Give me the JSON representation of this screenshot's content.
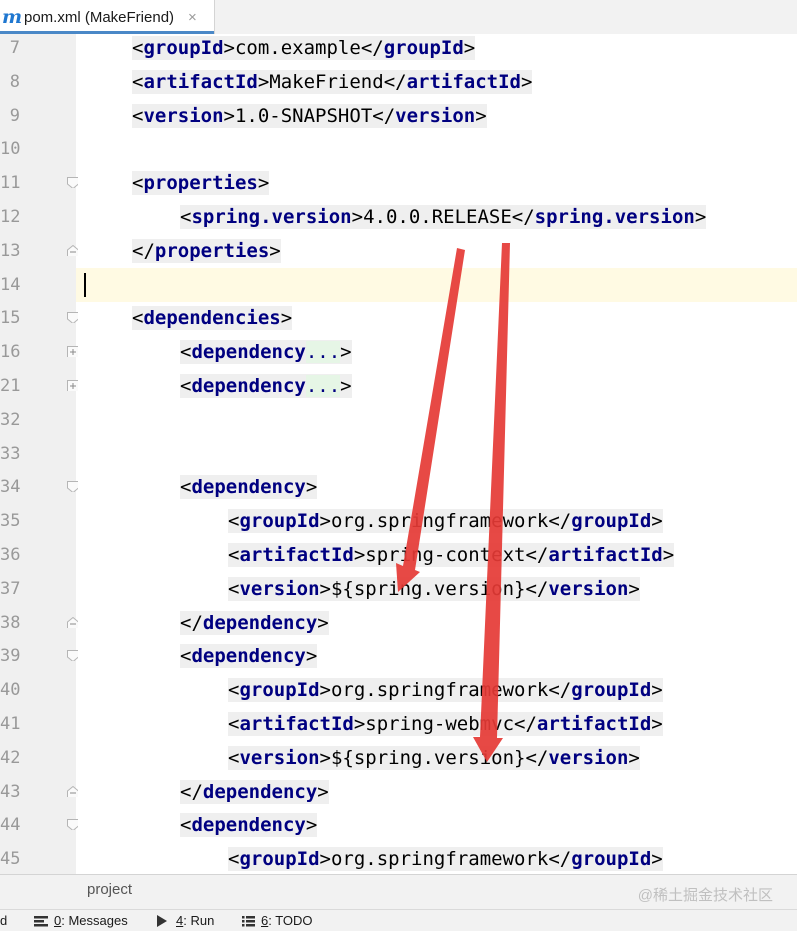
{
  "tab": {
    "icon_letter": "m",
    "title": "pom.xml (MakeFriend)",
    "close": "×"
  },
  "lines": [
    {
      "num": "7",
      "segments": [
        {
          "t": "<",
          "k": "brk"
        },
        {
          "t": "groupId",
          "k": "tag"
        },
        {
          "t": ">",
          "k": "brk"
        },
        {
          "t": "com.example",
          "k": "txt"
        },
        {
          "t": "</",
          "k": "brk"
        },
        {
          "t": "groupId",
          "k": "tag"
        },
        {
          "t": ">",
          "k": "brk"
        }
      ],
      "indent": 1,
      "fold": ""
    },
    {
      "num": "8",
      "segments": [
        {
          "t": "<",
          "k": "brk"
        },
        {
          "t": "artifactId",
          "k": "tag"
        },
        {
          "t": ">",
          "k": "brk"
        },
        {
          "t": "MakeFriend",
          "k": "txt"
        },
        {
          "t": "</",
          "k": "brk"
        },
        {
          "t": "artifactId",
          "k": "tag"
        },
        {
          "t": ">",
          "k": "brk"
        }
      ],
      "indent": 1,
      "fold": ""
    },
    {
      "num": "9",
      "segments": [
        {
          "t": "<",
          "k": "brk"
        },
        {
          "t": "version",
          "k": "tag"
        },
        {
          "t": ">",
          "k": "brk"
        },
        {
          "t": "1.0-SNAPSHOT",
          "k": "txt"
        },
        {
          "t": "</",
          "k": "brk"
        },
        {
          "t": "version",
          "k": "tag"
        },
        {
          "t": ">",
          "k": "brk"
        }
      ],
      "indent": 1,
      "fold": ""
    },
    {
      "num": "10",
      "segments": [],
      "indent": 1,
      "fold": ""
    },
    {
      "num": "11",
      "segments": [
        {
          "t": "<",
          "k": "brk"
        },
        {
          "t": "properties",
          "k": "tag"
        },
        {
          "t": ">",
          "k": "brk"
        }
      ],
      "indent": 1,
      "fold": "open"
    },
    {
      "num": "12",
      "segments": [
        {
          "t": "<",
          "k": "brk"
        },
        {
          "t": "spring.version",
          "k": "tag"
        },
        {
          "t": ">",
          "k": "brk"
        },
        {
          "t": "4.0.0.RELEASE",
          "k": "txt"
        },
        {
          "t": "</",
          "k": "brk"
        },
        {
          "t": "spring.version",
          "k": "tag"
        },
        {
          "t": ">",
          "k": "brk"
        }
      ],
      "indent": 2,
      "fold": ""
    },
    {
      "num": "13",
      "segments": [
        {
          "t": "</",
          "k": "brk"
        },
        {
          "t": "properties",
          "k": "tag"
        },
        {
          "t": ">",
          "k": "brk"
        }
      ],
      "indent": 1,
      "fold": "close"
    },
    {
      "num": "14",
      "segments": [],
      "indent": 1,
      "fold": "",
      "current": true
    },
    {
      "num": "15",
      "segments": [
        {
          "t": "<",
          "k": "brk"
        },
        {
          "t": "dependencies",
          "k": "tag"
        },
        {
          "t": ">",
          "k": "brk"
        }
      ],
      "indent": 1,
      "fold": "open"
    },
    {
      "num": "16",
      "segments": [
        {
          "t": "<",
          "k": "brk"
        },
        {
          "t": "dependency",
          "k": "tag"
        },
        {
          "t": "...",
          "k": "dots"
        },
        {
          "t": ">",
          "k": "brk"
        }
      ],
      "indent": 2,
      "fold": "plus"
    },
    {
      "num": "21",
      "segments": [
        {
          "t": "<",
          "k": "brk"
        },
        {
          "t": "dependency",
          "k": "tag"
        },
        {
          "t": "...",
          "k": "dots"
        },
        {
          "t": ">",
          "k": "brk"
        }
      ],
      "indent": 2,
      "fold": "plus"
    },
    {
      "num": "32",
      "segments": [],
      "indent": 2,
      "fold": ""
    },
    {
      "num": "33",
      "segments": [],
      "indent": 2,
      "fold": ""
    },
    {
      "num": "34",
      "segments": [
        {
          "t": "<",
          "k": "brk"
        },
        {
          "t": "dependency",
          "k": "tag"
        },
        {
          "t": ">",
          "k": "brk"
        }
      ],
      "indent": 2,
      "fold": "open"
    },
    {
      "num": "35",
      "segments": [
        {
          "t": "<",
          "k": "brk"
        },
        {
          "t": "groupId",
          "k": "tag"
        },
        {
          "t": ">",
          "k": "brk"
        },
        {
          "t": "org.springframework",
          "k": "txt"
        },
        {
          "t": "</",
          "k": "brk"
        },
        {
          "t": "groupId",
          "k": "tag"
        },
        {
          "t": ">",
          "k": "brk"
        }
      ],
      "indent": 3,
      "fold": ""
    },
    {
      "num": "36",
      "segments": [
        {
          "t": "<",
          "k": "brk"
        },
        {
          "t": "artifactId",
          "k": "tag"
        },
        {
          "t": ">",
          "k": "brk"
        },
        {
          "t": "spring-context",
          "k": "txt"
        },
        {
          "t": "</",
          "k": "brk"
        },
        {
          "t": "artifactId",
          "k": "tag"
        },
        {
          "t": ">",
          "k": "brk"
        }
      ],
      "indent": 3,
      "fold": ""
    },
    {
      "num": "37",
      "segments": [
        {
          "t": "<",
          "k": "brk"
        },
        {
          "t": "version",
          "k": "tag"
        },
        {
          "t": ">",
          "k": "brk"
        },
        {
          "t": "${spring.version}",
          "k": "txt"
        },
        {
          "t": "</",
          "k": "brk"
        },
        {
          "t": "version",
          "k": "tag"
        },
        {
          "t": ">",
          "k": "brk"
        }
      ],
      "indent": 3,
      "fold": ""
    },
    {
      "num": "38",
      "segments": [
        {
          "t": "</",
          "k": "brk"
        },
        {
          "t": "dependency",
          "k": "tag"
        },
        {
          "t": ">",
          "k": "brk"
        }
      ],
      "indent": 2,
      "fold": "close"
    },
    {
      "num": "39",
      "segments": [
        {
          "t": "<",
          "k": "brk"
        },
        {
          "t": "dependency",
          "k": "tag"
        },
        {
          "t": ">",
          "k": "brk"
        }
      ],
      "indent": 2,
      "fold": "open"
    },
    {
      "num": "40",
      "segments": [
        {
          "t": "<",
          "k": "brk"
        },
        {
          "t": "groupId",
          "k": "tag"
        },
        {
          "t": ">",
          "k": "brk"
        },
        {
          "t": "org.springframework",
          "k": "txt"
        },
        {
          "t": "</",
          "k": "brk"
        },
        {
          "t": "groupId",
          "k": "tag"
        },
        {
          "t": ">",
          "k": "brk"
        }
      ],
      "indent": 3,
      "fold": ""
    },
    {
      "num": "41",
      "segments": [
        {
          "t": "<",
          "k": "brk"
        },
        {
          "t": "artifactId",
          "k": "tag"
        },
        {
          "t": ">",
          "k": "brk"
        },
        {
          "t": "spring-webmvc",
          "k": "txt"
        },
        {
          "t": "</",
          "k": "brk"
        },
        {
          "t": "artifactId",
          "k": "tag"
        },
        {
          "t": ">",
          "k": "brk"
        }
      ],
      "indent": 3,
      "fold": ""
    },
    {
      "num": "42",
      "segments": [
        {
          "t": "<",
          "k": "brk"
        },
        {
          "t": "version",
          "k": "tag"
        },
        {
          "t": ">",
          "k": "brk"
        },
        {
          "t": "${spring.version}",
          "k": "txt"
        },
        {
          "t": "</",
          "k": "brk"
        },
        {
          "t": "version",
          "k": "tag"
        },
        {
          "t": ">",
          "k": "brk"
        }
      ],
      "indent": 3,
      "fold": ""
    },
    {
      "num": "43",
      "segments": [
        {
          "t": "</",
          "k": "brk"
        },
        {
          "t": "dependency",
          "k": "tag"
        },
        {
          "t": ">",
          "k": "brk"
        }
      ],
      "indent": 2,
      "fold": "close"
    },
    {
      "num": "44",
      "segments": [
        {
          "t": "<",
          "k": "brk"
        },
        {
          "t": "dependency",
          "k": "tag"
        },
        {
          "t": ">",
          "k": "brk"
        }
      ],
      "indent": 2,
      "fold": "open"
    },
    {
      "num": "45",
      "segments": [
        {
          "t": "<",
          "k": "brk"
        },
        {
          "t": "groupId",
          "k": "tag"
        },
        {
          "t": ">",
          "k": "brk"
        },
        {
          "t": "org.springframework",
          "k": "txt"
        },
        {
          "t": "</",
          "k": "brk"
        },
        {
          "t": "groupId",
          "k": "tag"
        },
        {
          "t": ">",
          "k": "brk"
        }
      ],
      "indent": 3,
      "fold": ""
    }
  ],
  "breadcrumb": "project",
  "statusbar": {
    "left_fragment": "d",
    "items": [
      {
        "name": "messages",
        "icon": "messages-icon",
        "hotkey": "0",
        "label": ": Messages"
      },
      {
        "name": "run",
        "icon": "run-icon",
        "hotkey": "4",
        "label": ": Run"
      },
      {
        "name": "todo",
        "icon": "todo-icon",
        "hotkey": "6",
        "label": ": TODO"
      }
    ]
  },
  "watermark": "@稀土掘金技术社区",
  "colors": {
    "tag": "#000080",
    "arrow": "#e53935",
    "current_line": "#fffae3",
    "gutter": "#f0f0f0"
  }
}
